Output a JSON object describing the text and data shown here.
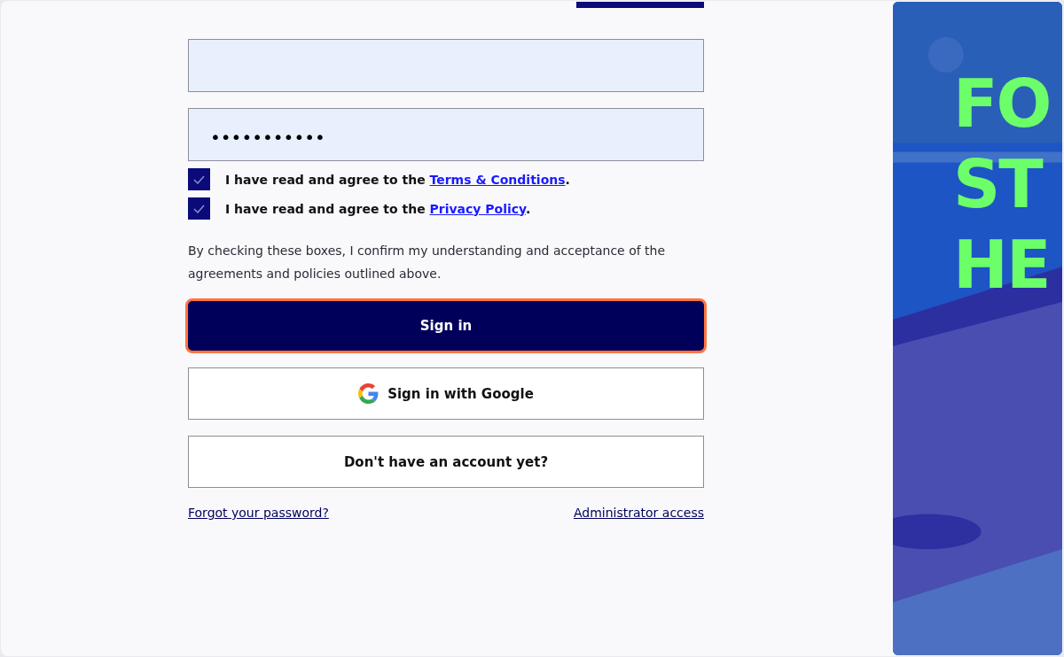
{
  "password_field": {
    "value": "•••••••••••"
  },
  "agreements": [
    {
      "text": "I have read and agree to the ",
      "link": "Terms & Conditions",
      "suffix": ".",
      "checked": true
    },
    {
      "text": "I have read and agree to the ",
      "link": "Privacy Policy",
      "suffix": ".",
      "checked": true
    }
  ],
  "consent_note": "By checking these boxes, I confirm my understanding and acceptance of the agreements and policies outlined above.",
  "sign_in_button": {
    "label": "Sign in",
    "focused": true
  },
  "google_button": {
    "label": "Sign in with Google"
  },
  "signup_button": {
    "label": "Don't have an account yet?"
  },
  "links": [
    "Forgot your password?",
    "Administrator access"
  ],
  "hero": {
    "kind": "picture",
    "headline": [
      "FO",
      "ST",
      "HE"
    ]
  }
}
